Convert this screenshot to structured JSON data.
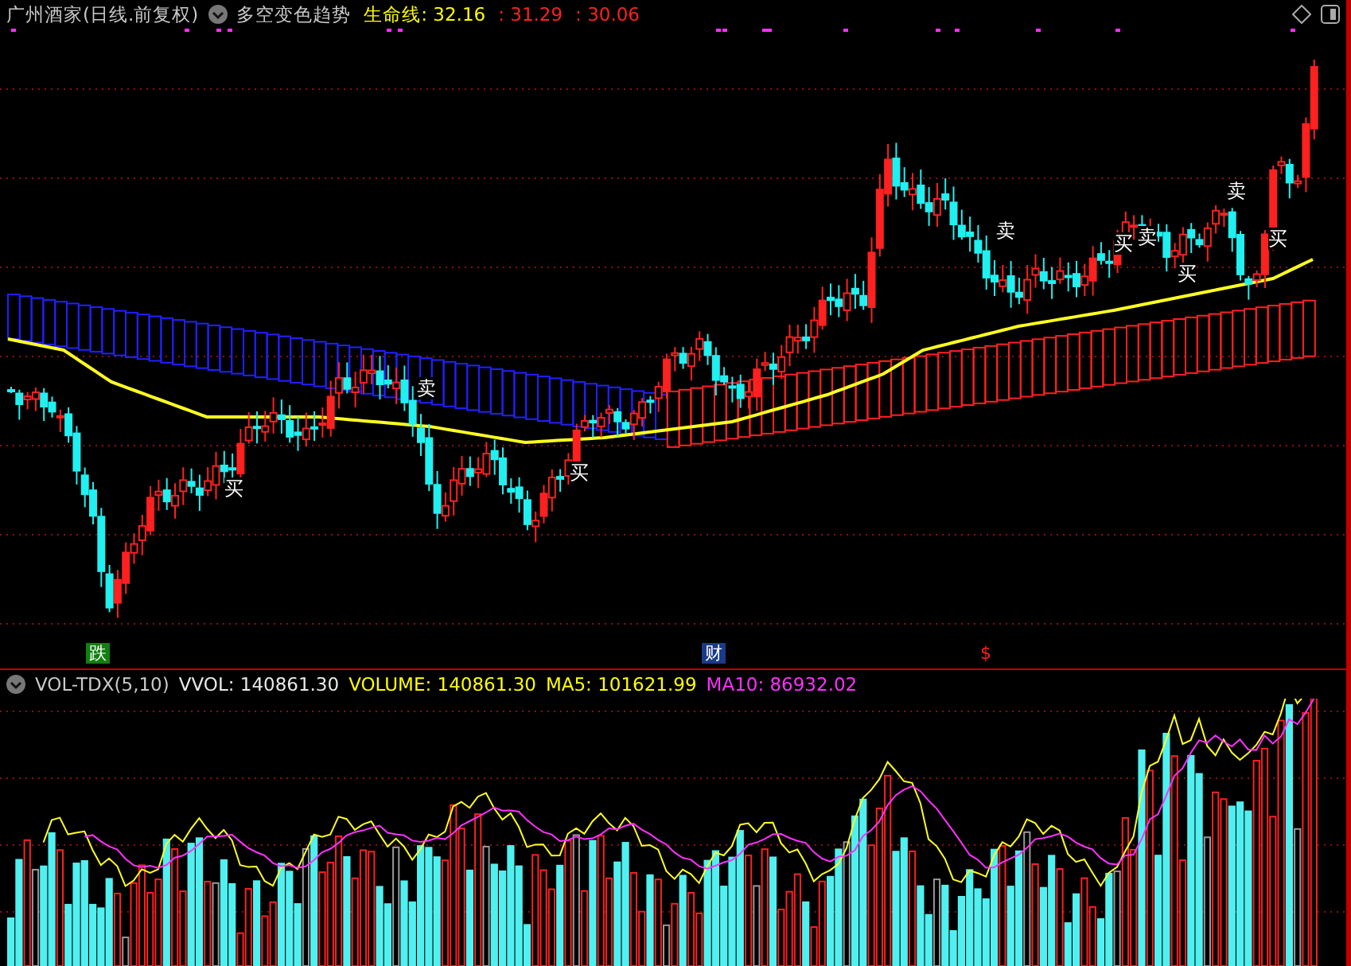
{
  "header": {
    "title": "广州酒家(日线.前复权)",
    "indicator": "多空变色趋势",
    "values": [
      {
        "text": "生命线: 32.16",
        "color": "#ffff00"
      },
      {
        "text": ": 31.29",
        "color": "#ff2020"
      },
      {
        "text": ": 30.06",
        "color": "#ff2020"
      }
    ]
  },
  "signals": [
    {
      "text": "买"
    },
    {
      "text": "卖"
    },
    {
      "text": "买"
    },
    {
      "text": "卖"
    },
    {
      "text": "买"
    },
    {
      "text": "卖"
    },
    {
      "text": "买"
    },
    {
      "text": "卖"
    },
    {
      "text": "买"
    }
  ],
  "markers": [
    {
      "text": "跌",
      "kind": "fall"
    },
    {
      "text": "财",
      "kind": "finance"
    },
    {
      "text": "$",
      "kind": "dollar"
    }
  ],
  "volume": {
    "name": "VOL-TDX(5,10)",
    "values": [
      {
        "text": "VVOL: 140861.30",
        "color": "#e8e8e8"
      },
      {
        "text": "VOLUME: 140861.30",
        "color": "#ffff00"
      },
      {
        "text": "MA5: 101621.99",
        "color": "#ffff00"
      },
      {
        "text": "MA10: 86932.02",
        "color": "#ff30ff"
      }
    ]
  }
}
